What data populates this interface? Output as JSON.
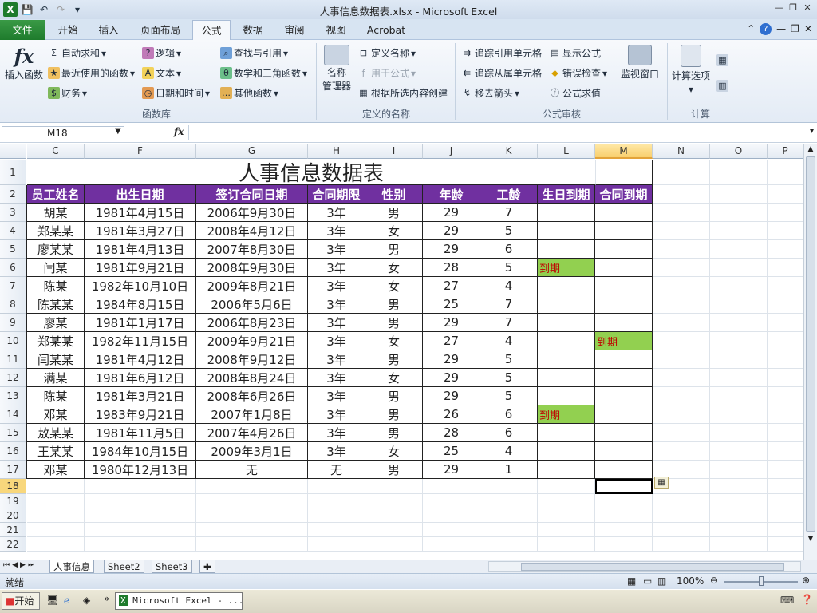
{
  "window": {
    "title": "人事信息数据表.xlsx - Microsoft Excel"
  },
  "ribbon_tabs": {
    "file": "文件",
    "home": "开始",
    "insert": "插入",
    "layout": "页面布局",
    "formulas": "公式",
    "data": "数据",
    "review": "审阅",
    "view": "视图",
    "acrobat": "Acrobat"
  },
  "ribbon": {
    "insert_function": "插入函数",
    "autosum": "自动求和",
    "recent": "最近使用的函数",
    "financial": "财务",
    "logical": "逻辑",
    "text": "文本",
    "datetime": "日期和时间",
    "lookup": "查找与引用",
    "math": "数学和三角函数",
    "other": "其他函数",
    "group_library": "函数库",
    "name_manager_1": "名称",
    "name_manager_2": "管理器",
    "define_name": "定义名称",
    "use_in_formula": "用于公式",
    "create_from_selection": "根据所选内容创建",
    "group_names": "定义的名称",
    "trace_precedents": "追踪引用单元格",
    "trace_dependents": "追踪从属单元格",
    "remove_arrows": "移去箭头",
    "show_formulas": "显示公式",
    "error_checking": "错误检查",
    "evaluate": "公式求值",
    "watch_window": "监视窗口",
    "group_auditing": "公式审核",
    "calc_options": "计算选项",
    "group_calc": "计算"
  },
  "formula_bar": {
    "name_box": "M18",
    "fx": "fx",
    "value": ""
  },
  "columns": [
    "C",
    "F",
    "G",
    "H",
    "I",
    "J",
    "K",
    "L",
    "M",
    "N",
    "O",
    "P"
  ],
  "rows": [
    "1",
    "2",
    "3",
    "4",
    "5",
    "6",
    "7",
    "8",
    "9",
    "10",
    "11",
    "12",
    "13",
    "14",
    "15",
    "16",
    "17",
    "18",
    "19",
    "20",
    "21",
    "22"
  ],
  "sheet": {
    "title": "人事信息数据表",
    "headers": [
      "员工姓名",
      "出生日期",
      "签订合同日期",
      "合同期限",
      "性别",
      "年龄",
      "工龄",
      "生日到期",
      "合同到期"
    ],
    "rows": [
      [
        "胡某",
        "1981年4月15日",
        "2006年9月30日",
        "3年",
        "男",
        "29",
        "7",
        "",
        ""
      ],
      [
        "郑某某",
        "1981年3月27日",
        "2008年4月12日",
        "3年",
        "女",
        "29",
        "5",
        "",
        ""
      ],
      [
        "廖某某",
        "1981年4月13日",
        "2007年8月30日",
        "3年",
        "男",
        "29",
        "6",
        "",
        ""
      ],
      [
        "闫某",
        "1981年9月21日",
        "2008年9月30日",
        "3年",
        "女",
        "28",
        "5",
        "到期",
        ""
      ],
      [
        "陈某",
        "1982年10月10日",
        "2009年8月21日",
        "3年",
        "女",
        "27",
        "4",
        "",
        ""
      ],
      [
        "陈某某",
        "1984年8月15日",
        "2006年5月6日",
        "3年",
        "男",
        "25",
        "7",
        "",
        ""
      ],
      [
        "廖某",
        "1981年1月17日",
        "2006年8月23日",
        "3年",
        "男",
        "29",
        "7",
        "",
        ""
      ],
      [
        "郑某某",
        "1982年11月15日",
        "2009年9月21日",
        "3年",
        "女",
        "27",
        "4",
        "",
        "到期"
      ],
      [
        "闫某某",
        "1981年4月12日",
        "2008年9月12日",
        "3年",
        "男",
        "29",
        "5",
        "",
        ""
      ],
      [
        "满某",
        "1981年6月12日",
        "2008年8月24日",
        "3年",
        "女",
        "29",
        "5",
        "",
        ""
      ],
      [
        "陈某",
        "1981年3月21日",
        "2008年6月26日",
        "3年",
        "男",
        "29",
        "5",
        "",
        ""
      ],
      [
        "邓某",
        "1983年9月21日",
        "2007年1月8日",
        "3年",
        "男",
        "26",
        "6",
        "到期",
        ""
      ],
      [
        "敖某某",
        "1981年11月5日",
        "2007年4月26日",
        "3年",
        "男",
        "28",
        "6",
        "",
        ""
      ],
      [
        "王某某",
        "1984年10月15日",
        "2009年3月1日",
        "3年",
        "女",
        "25",
        "4",
        "",
        ""
      ],
      [
        "邓某",
        "1980年12月13日",
        "无",
        "无",
        "男",
        "29",
        "1",
        "",
        ""
      ]
    ]
  },
  "colors": {
    "header_bg": "#7030a0",
    "due_bg": "#92d050",
    "due_text": "#c00000"
  },
  "sheet_tabs": [
    "人事信息",
    "Sheet2",
    "Sheet3"
  ],
  "status": {
    "ready": "就绪",
    "zoom": "100%"
  },
  "taskbar": {
    "start": "开始",
    "task": "Microsoft Excel - ..."
  }
}
